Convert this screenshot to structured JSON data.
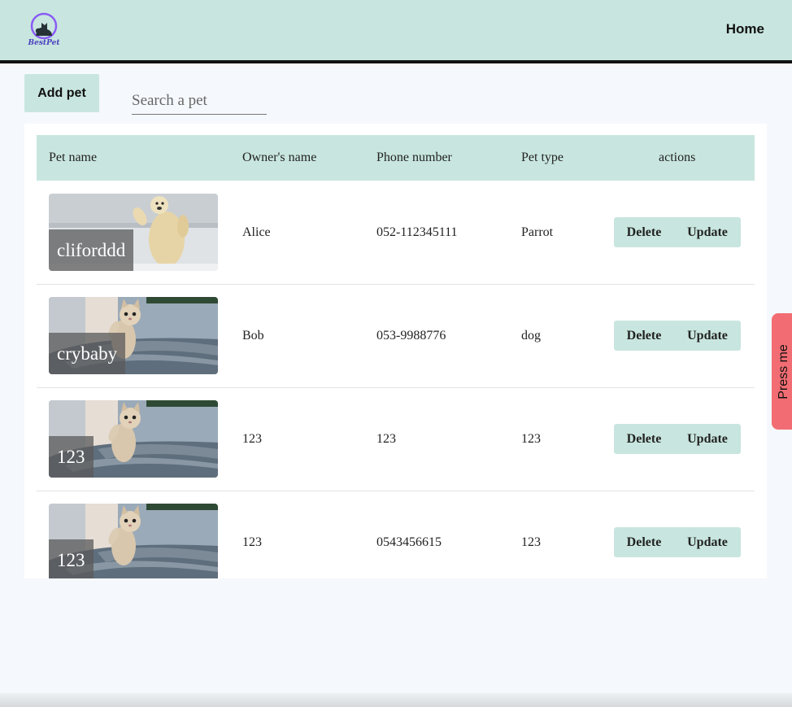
{
  "nav": {
    "home_label": "Home",
    "logo_text": "BestPet"
  },
  "toolbar": {
    "add_pet_label": "Add pet",
    "search_placeholder": "Search a pet"
  },
  "table": {
    "headers": [
      "Pet name",
      "Owner's name",
      "Phone number",
      "Pet type",
      "actions"
    ],
    "rows": [
      {
        "pet_name": "cliforddd",
        "owner": "Alice",
        "phone": "052-112345111",
        "type": "Parrot",
        "image": "polar-bear"
      },
      {
        "pet_name": "crybaby",
        "owner": "Bob",
        "phone": "053-9988776",
        "type": "dog",
        "image": "kitten"
      },
      {
        "pet_name": "123",
        "owner": "123",
        "phone": "123",
        "type": "123",
        "image": "kitten"
      },
      {
        "pet_name": "123",
        "owner": "123",
        "phone": "0543456615",
        "type": "123",
        "image": "kitten"
      }
    ],
    "delete_label": "Delete",
    "update_label": "Update"
  },
  "side_button": {
    "label": "Press me"
  },
  "colors": {
    "accent": "#c8e6df",
    "side_button": "#f26d73",
    "background": "#f5f8fc"
  }
}
